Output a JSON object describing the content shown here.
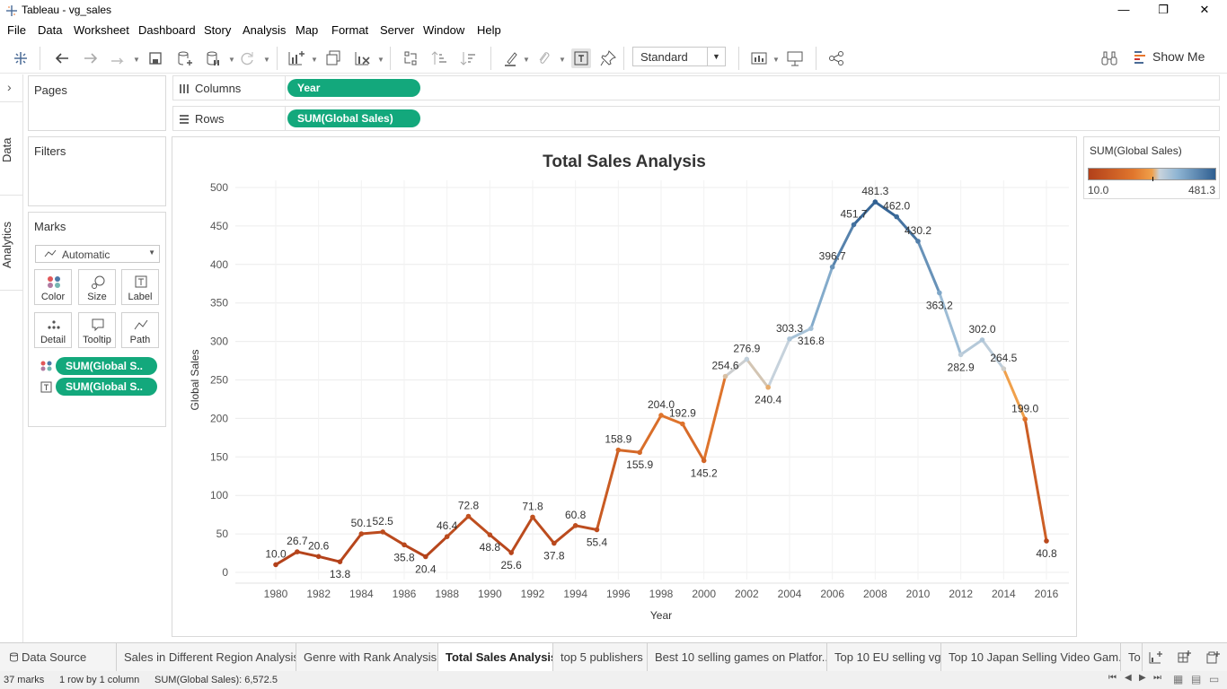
{
  "window": {
    "title": "Tableau - vg_sales",
    "minimize": "—",
    "restore": "❐",
    "close": "✕"
  },
  "menu": [
    "File",
    "Data",
    "Worksheet",
    "Dashboard",
    "Story",
    "Analysis",
    "Map",
    "Format",
    "Server",
    "Window",
    "Help"
  ],
  "toolbar": {
    "fit_value": "Standard",
    "show_me": "Show Me"
  },
  "side_tabs": {
    "data": "Data",
    "analytics": "Analytics"
  },
  "cards": {
    "pages": "Pages",
    "filters": "Filters",
    "marks": "Marks"
  },
  "marks": {
    "type": "Automatic",
    "buttons": [
      "Color",
      "Size",
      "Label",
      "Detail",
      "Tooltip",
      "Path"
    ],
    "pills": [
      "SUM(Global S..",
      "SUM(Global S.."
    ]
  },
  "shelves": {
    "columns_label": "Columns",
    "columns_pill": "Year",
    "rows_label": "Rows",
    "rows_pill": "SUM(Global Sales)"
  },
  "legend": {
    "title": "SUM(Global Sales)",
    "min": "10.0",
    "max": "481.3"
  },
  "chart_data": {
    "type": "line",
    "title": "Total Sales Analysis",
    "xlabel": "Year",
    "ylabel": "Global Sales",
    "x": [
      1980,
      1981,
      1982,
      1983,
      1984,
      1985,
      1986,
      1987,
      1988,
      1989,
      1990,
      1991,
      1992,
      1993,
      1994,
      1995,
      1996,
      1997,
      1998,
      1999,
      2000,
      2001,
      2002,
      2003,
      2004,
      2005,
      2006,
      2007,
      2008,
      2009,
      2010,
      2011,
      2012,
      2013,
      2014,
      2015,
      2016
    ],
    "values": [
      10.0,
      26.7,
      20.6,
      13.8,
      50.1,
      52.5,
      35.8,
      20.4,
      46.4,
      72.8,
      48.8,
      25.6,
      71.8,
      37.8,
      60.8,
      55.4,
      158.9,
      155.9,
      204.0,
      192.9,
      145.2,
      254.6,
      276.9,
      240.4,
      303.3,
      316.8,
      396.7,
      451.7,
      481.3,
      462.0,
      430.2,
      363.2,
      282.9,
      302.0,
      264.5,
      199.0,
      40.8
    ],
    "labels": [
      "10.0",
      "26.7",
      "20.6",
      "13.8",
      "50.1",
      "52.5",
      "35.8",
      "20.4",
      "46.4",
      "72.8",
      "48.8",
      "25.6",
      "71.8",
      "37.8",
      "60.8",
      "55.4",
      "158.9",
      "155.9",
      "204.0",
      "192.9",
      "145.2",
      "254.6",
      "276.9",
      "240.4",
      "303.3",
      "316.8",
      "396.7",
      "451.7",
      "481.3",
      "462.0",
      "430.2",
      "363.2",
      "282.9",
      "302.0",
      "264.5",
      "199.0",
      "40.8"
    ],
    "label_below": [
      false,
      false,
      false,
      true,
      false,
      false,
      true,
      true,
      false,
      false,
      true,
      true,
      false,
      true,
      false,
      true,
      false,
      true,
      false,
      false,
      true,
      false,
      false,
      true,
      false,
      true,
      false,
      false,
      false,
      false,
      false,
      true,
      true,
      false,
      false,
      false,
      true
    ],
    "xticks": [
      "1980",
      "1982",
      "1984",
      "1986",
      "1988",
      "1990",
      "1992",
      "1994",
      "1996",
      "1998",
      "2000",
      "2002",
      "2004",
      "2006",
      "2008",
      "2010",
      "2012",
      "2014",
      "2016"
    ],
    "yticks": [
      "0",
      "50",
      "100",
      "150",
      "200",
      "250",
      "300",
      "350",
      "400",
      "450",
      "500"
    ],
    "ylim": [
      0,
      500
    ],
    "color_scale": {
      "low": "#b2401a",
      "mid_low": "#f0a04a",
      "mid": "#c8d3dc",
      "high": "#2f5f91"
    },
    "grid": true
  },
  "sheet_tabs": [
    "Data Source",
    "Sales in Different Region Analysis",
    "Genre with Rank Analysis",
    "Total Sales Analysis",
    "top 5 publishers",
    "Best 10 selling games on Platfor...",
    "Top 10 EU selling vg",
    "Top 10 Japan Selling Video Gam...",
    "To"
  ],
  "status": {
    "marks": "37 marks",
    "rows": "1 row by 1 column",
    "sum": "SUM(Global Sales): 6,572.5"
  }
}
